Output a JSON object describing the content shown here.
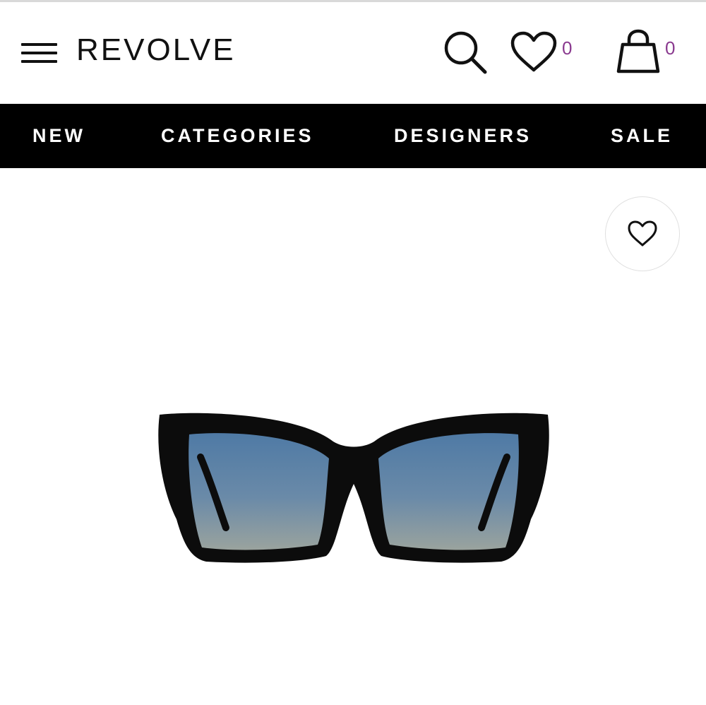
{
  "header": {
    "logo": "REVOLVE",
    "wishlist_count": "0",
    "bag_count": "0"
  },
  "nav": {
    "items": [
      "NEW",
      "CATEGORIES",
      "DESIGNERS",
      "SALE"
    ]
  },
  "product": {
    "frame_color": "#0c0c0c",
    "lens_top_color": "#4f7aa5",
    "lens_bottom_color": "#9aa39e"
  },
  "colors": {
    "badge": "#8a3a8f",
    "nav_bg": "#000000"
  }
}
